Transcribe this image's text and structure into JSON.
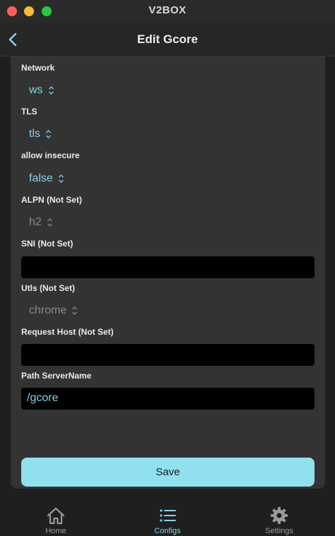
{
  "window": {
    "title": "V2BOX"
  },
  "nav": {
    "title": "Edit Gcore",
    "back_icon": "chevron-left-icon"
  },
  "form": {
    "network": {
      "label": "Network",
      "value": "ws"
    },
    "tls": {
      "label": "TLS",
      "value": "tls"
    },
    "allow_insecure": {
      "label": "allow insecure",
      "value": "false"
    },
    "alpn": {
      "label": "ALPN (Not Set)",
      "value": "h2"
    },
    "sni": {
      "label": "SNI (Not Set)",
      "value": ""
    },
    "utls": {
      "label": "Utls (Not Set)",
      "value": "chrome"
    },
    "request_host": {
      "label": "Request Host (Not Set)",
      "value": ""
    },
    "path_servername": {
      "label": "Path ServerName",
      "value": "/gcore"
    }
  },
  "save_label": "Save",
  "tabs": [
    {
      "label": "Home",
      "icon": "house-icon",
      "active": false
    },
    {
      "label": "Configs",
      "icon": "list-icon",
      "active": true
    },
    {
      "label": "Settings",
      "icon": "gear-icon",
      "active": false
    }
  ],
  "colors": {
    "accent": "#7fd4ee",
    "save_button": "#91e0f0",
    "panel": "#333333",
    "background": "#1f1f1f"
  }
}
